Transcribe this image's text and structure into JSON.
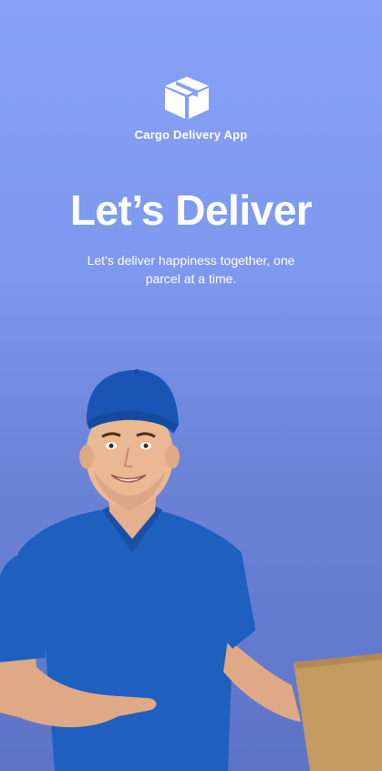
{
  "app": {
    "logo_icon": "package-box-icon",
    "name": "Cargo Delivery App"
  },
  "onboarding": {
    "headline": "Let’s Deliver",
    "subtitle": "Let’s deliver happiness together, one parcel at a time."
  },
  "hero": {
    "image": "delivery-man-pointing-at-parcel"
  },
  "colors": {
    "background_top": "#86a1f6",
    "background_bottom": "#5d74c6",
    "uniform_blue": "#1f5fbf",
    "box_brown": "#c49a63",
    "text": "#ffffff"
  }
}
